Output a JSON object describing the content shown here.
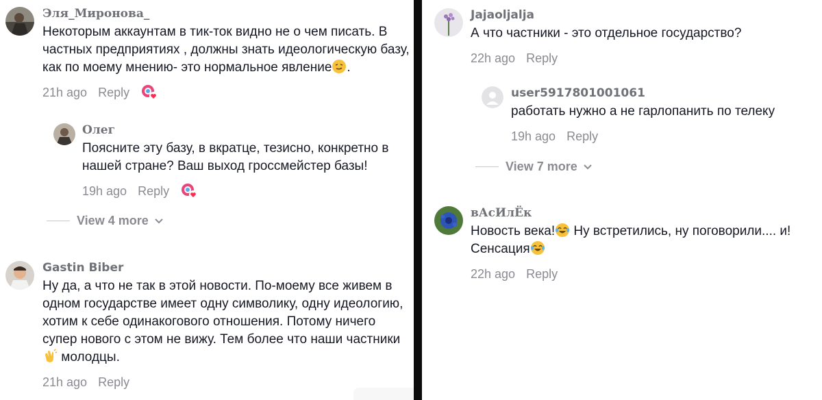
{
  "left": {
    "comments": [
      {
        "username": "Эля_Миронова_",
        "text": "Некоторым аккаунтам в тик-ток видно не о чем писать. В частных предприятиях , должны знать идеологическую базу, как по моему мнению- это нормальное явление",
        "text_end": ".",
        "emoji": "smirk-emoji",
        "time": "21h ago",
        "reply": "Reply"
      },
      {
        "username": "Олег",
        "text": "Поясните эту базу, в вкратце, тезисно, конкретно в нашей стране? Ваш выход гроссмейстер базы!",
        "time": "19h ago",
        "reply": "Reply"
      },
      {
        "username": "Gastin Biber",
        "text_line1": "Ну да, а что не так в этой новости. По-моему все живем в одном государстве имеет одну символику, одну идеологию, хотим к себе одинакогового отношения. Потому ничего супер нового с этом не вижу. Тем более что наши частники",
        "text_line2": "молодцы.",
        "emoji": "clap-emoji",
        "time": "21h ago",
        "reply": "Reply"
      }
    ],
    "view_more": "View 4 more"
  },
  "right": {
    "comments": [
      {
        "username": "Jajaoljalja",
        "text": "А что частники - это отдельное государство?",
        "time": "22h ago",
        "reply": "Reply"
      },
      {
        "username": "user5917801001061",
        "text": "работать нужно а не гарлопанить по телеку",
        "time": "19h ago",
        "reply": "Reply"
      },
      {
        "username": "вАсИлЁк",
        "text_a": "Новость века!",
        "text_b": " Ну встретились, ну поговорили.... и!",
        "text_c": "Сенсация",
        "emoji": "laughing-tears-emoji",
        "time": "22h ago",
        "reply": "Reply"
      }
    ],
    "view_more": "View 7 more"
  },
  "colors": {
    "text": "#161823",
    "muted": "#8a8b91",
    "divider": "#0c0c0c"
  }
}
